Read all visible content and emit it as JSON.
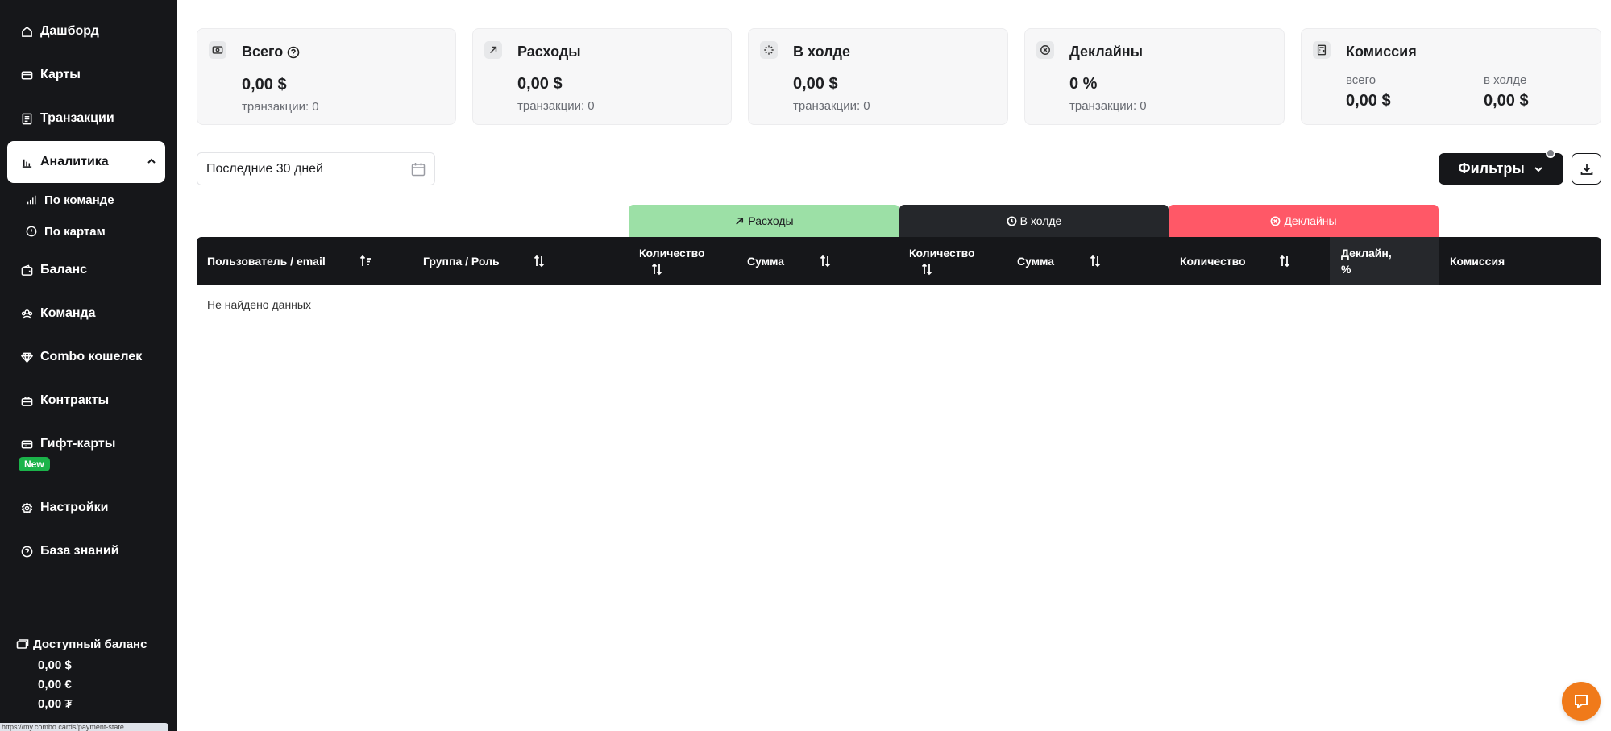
{
  "sidebar": {
    "items": [
      {
        "label": "Дашборд",
        "icon": "home-icon"
      },
      {
        "label": "Карты",
        "icon": "card-icon"
      },
      {
        "label": "Транзакции",
        "icon": "receipt-icon"
      },
      {
        "label": "Аналитика",
        "icon": "chart-bars-icon",
        "active": true
      },
      {
        "label": "Баланс",
        "icon": "wallet-icon"
      },
      {
        "label": "Команда",
        "icon": "team-icon"
      },
      {
        "label": "Combo кошелек",
        "icon": "diamond-icon"
      },
      {
        "label": "Контракты",
        "icon": "briefcase-icon"
      },
      {
        "label": "Гифт-карты",
        "icon": "gift-card-icon",
        "badge": "New"
      },
      {
        "label": "Настройки",
        "icon": "gear-icon"
      },
      {
        "label": "База знаний",
        "icon": "help-circle-icon"
      }
    ],
    "subitems": [
      {
        "label": "По команде",
        "icon": "signal-icon",
        "active": true
      },
      {
        "label": "По картам",
        "icon": "info-circle-icon"
      }
    ],
    "balance": {
      "title": "Доступный баланс",
      "usd": "0,00 $",
      "eur": "0,00 €",
      "uah": "0,00 ₮"
    },
    "status_url": "https://my.combo.cards/payment-state"
  },
  "stats": {
    "total": {
      "title": "Всего",
      "value": "0,00 $",
      "sub": "транзакции: 0"
    },
    "expenses": {
      "title": "Расходы",
      "value": "0,00 $",
      "sub": "транзакции: 0"
    },
    "hold": {
      "title": "В холде",
      "value": "0,00 $",
      "sub": "транзакции: 0"
    },
    "declines": {
      "title": "Деклайны",
      "value": "0 %",
      "sub": "транзакции: 0"
    },
    "commission": {
      "title": "Комиссия",
      "total_label": "всего",
      "total_value": "0,00 $",
      "hold_label": "в холде",
      "hold_value": "0,00 $"
    }
  },
  "toolbar": {
    "date_range": "Последние 30 дней",
    "filters_label": "Фильтры"
  },
  "table": {
    "groups": {
      "expenses": "Расходы",
      "hold": "В холде",
      "declines": "Деклайны"
    },
    "columns": {
      "user": "Пользователь / email",
      "group": "Группа / Роль",
      "exp_count": "Количество",
      "exp_sum": "Сумма",
      "hold_count": "Количество",
      "hold_sum": "Сумма",
      "dec_count": "Количество",
      "dec_pct_1": "Деклайн,",
      "dec_pct_2": "%",
      "commission": "Комиссия"
    },
    "empty_text": "Не найдено данных"
  },
  "colors": {
    "sidebar_bg": "#16171a",
    "accent": "#f6a01a",
    "expenses_group": "#9ce0a6",
    "hold_group": "#25272b",
    "declines_group": "#ff5867",
    "new_badge": "#1bb34a",
    "chat_button": "#f07a1a"
  }
}
